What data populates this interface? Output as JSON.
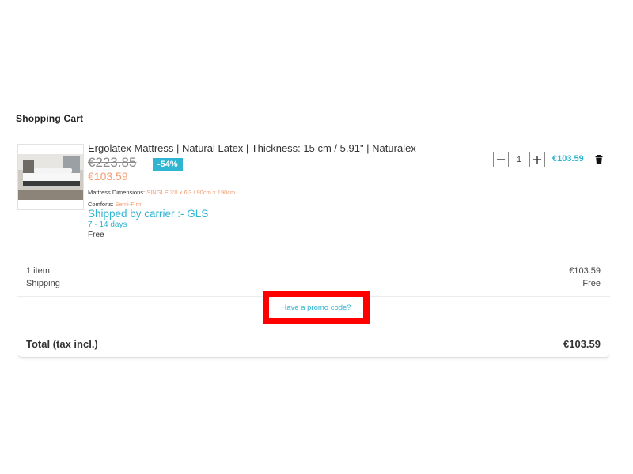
{
  "cart": {
    "title": "Shopping Cart"
  },
  "product": {
    "name": "Ergolatex Mattress | Natural Latex | Thickness: 15 cm / 5.91\" | Naturalex",
    "image_icon": "mattress-photo",
    "old_price": "€223.85",
    "discount": "-54%",
    "price": "€103.59",
    "attributes": [
      {
        "label": "Mattress Dimensions:",
        "value": "SINGLE 3'0 x 6'3 / 90cm x 190cm"
      },
      {
        "label": "Comforts:",
        "value": "Semi-Firm"
      }
    ],
    "carrier": "Shipped by carrier :- GLS",
    "delivery_time": "7 - 14 days",
    "delivery_cost": "Free",
    "quantity": "1",
    "line_total": "€103.59"
  },
  "summary": {
    "items_label": "1 item",
    "items_value": "€103.59",
    "shipping_label": "Shipping",
    "shipping_value": "Free",
    "promo_link": "Have a promo code?",
    "total_label": "Total (tax incl.)",
    "total_value": "€103.59"
  },
  "icons": {
    "minus": "minus-icon",
    "plus": "plus-icon",
    "delete": "trash-icon"
  },
  "colors": {
    "accent": "#2fb5d2",
    "price": "#f39d72",
    "highlight_box": "#ff0000"
  }
}
